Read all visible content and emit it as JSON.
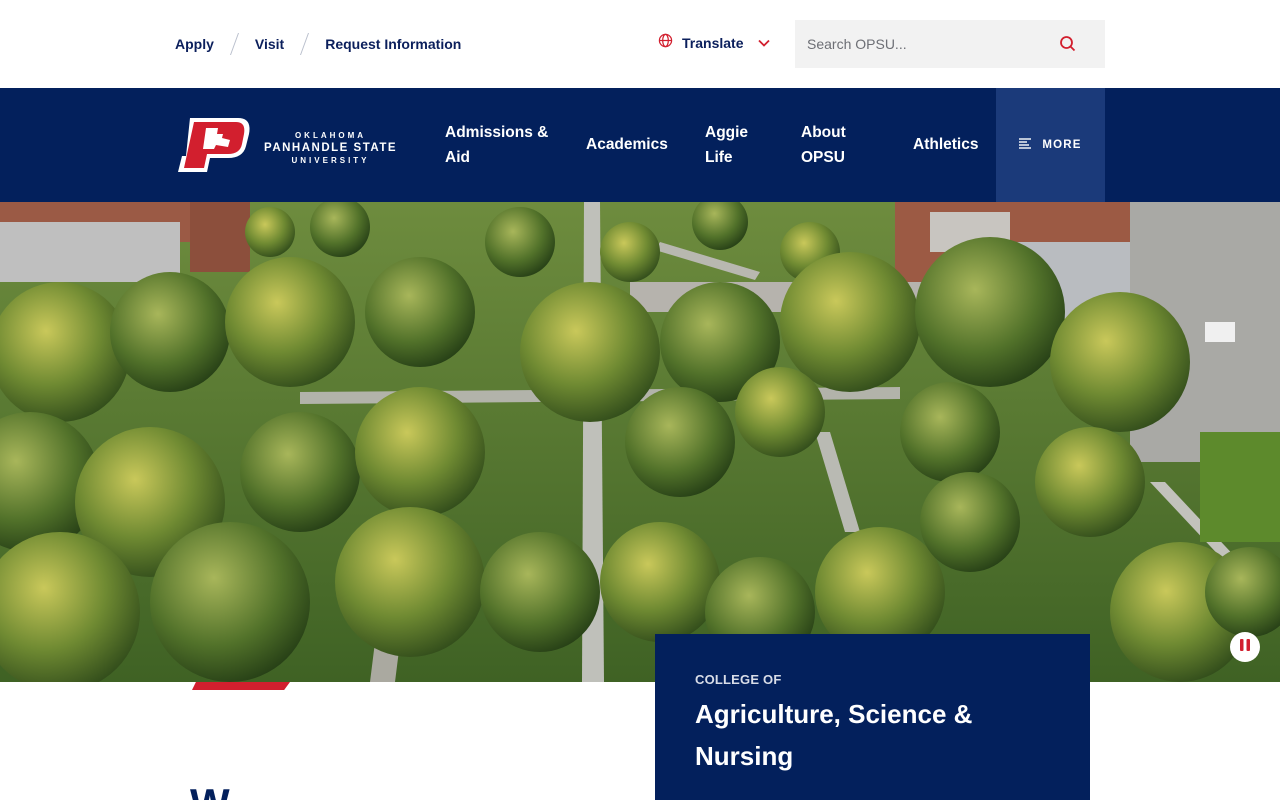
{
  "utility": {
    "links": [
      "Apply",
      "Visit",
      "Request Information"
    ],
    "translate_label": "Translate",
    "search_placeholder": "Search OPSU..."
  },
  "logo": {
    "line1": "OKLAHOMA",
    "line2": "PANHANDLE STATE",
    "line3": "UNIVERSITY",
    "icon": "p-logo-icon"
  },
  "nav": {
    "items": [
      {
        "line1": "Admissions &",
        "line2": "Aid"
      },
      {
        "line1": "Academics",
        "line2": ""
      },
      {
        "line1": "Aggie",
        "line2": "Life"
      },
      {
        "line1": "About",
        "line2": "OPSU"
      },
      {
        "line1": "Athletics",
        "line2": ""
      }
    ],
    "more_label": "MORE"
  },
  "hero": {
    "college_pre": "COLLEGE OF",
    "college_name_line1": "Agriculture, Science &",
    "college_name_line2": "Nursing",
    "heading_peek": "W"
  },
  "colors": {
    "navy": "#03205c",
    "red": "#d21f2e",
    "more_bg": "#1b3a7a"
  }
}
